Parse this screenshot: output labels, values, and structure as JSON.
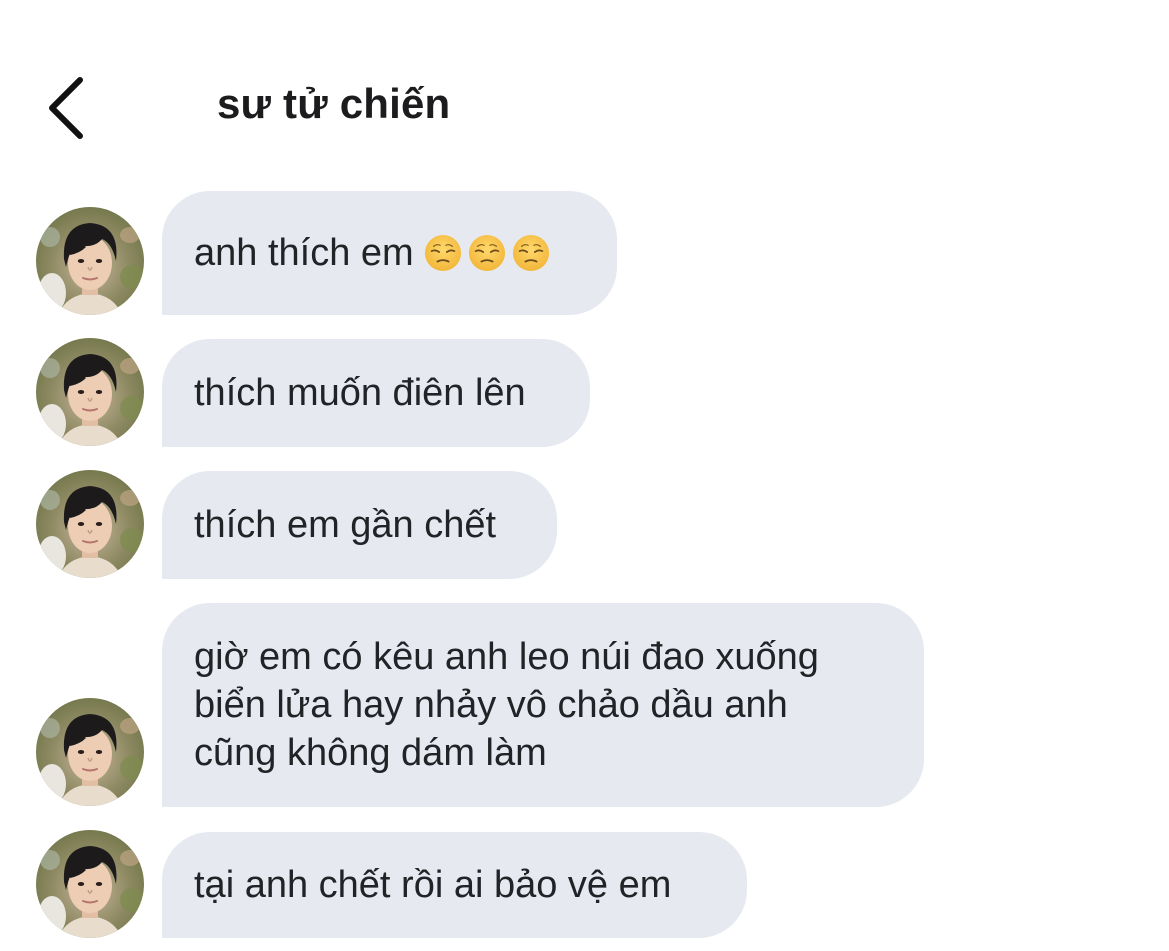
{
  "header": {
    "title": "sư tử chiến",
    "back_icon": "chevron-left-icon"
  },
  "messages": [
    {
      "text": "anh thích em",
      "emoji": [
        "pensive-face-emoji",
        "pensive-face-emoji",
        "pensive-face-emoji"
      ]
    },
    {
      "text": "thích muốn điên lên"
    },
    {
      "text": "thích em gần chết"
    },
    {
      "line1": "giờ em có kêu anh leo núi đao xuống",
      "line2": "biển lửa hay nhảy vô chảo dầu anh",
      "line3": "cũng không dám làm"
    },
    {
      "text": "tại anh chết rồi ai bảo vệ em"
    }
  ],
  "colors": {
    "bubble_bg": "#e6eaf0",
    "text": "#222326",
    "background": "#ffffff",
    "emoji_face": "#f7c54a"
  }
}
